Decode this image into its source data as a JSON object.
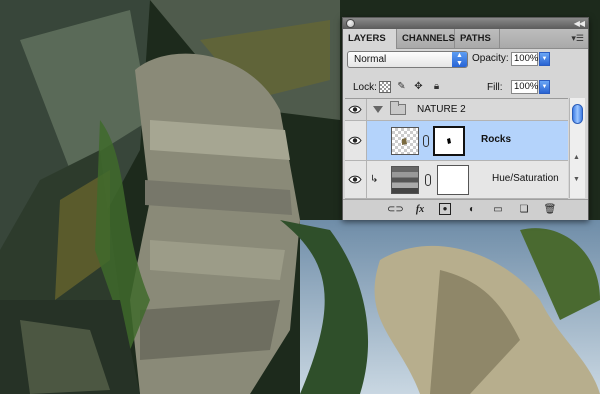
{
  "panel": {
    "tabs": [
      {
        "label": "LAYERS",
        "active": true
      },
      {
        "label": "CHANNELS",
        "active": false
      },
      {
        "label": "PATHS",
        "active": false
      }
    ],
    "blend_mode": "Normal",
    "opacity_label": "Opacity:",
    "opacity_value": "100%",
    "lock_label": "Lock:",
    "fill_label": "Fill:",
    "fill_value": "100%",
    "layers": [
      {
        "name": "NATURE 2",
        "type": "group",
        "expanded": true,
        "visible": true
      },
      {
        "name": "Rocks",
        "type": "layer-with-mask",
        "selected": true,
        "visible": true
      },
      {
        "name": "Hue/Saturation",
        "type": "adjustment",
        "clipped": true,
        "visible": true
      }
    ],
    "icons": {
      "eye": "eye-icon",
      "folder": "folder-icon",
      "link": "link-layers-icon",
      "fx": "layer-style-icon",
      "mask": "add-mask-icon",
      "adjustment": "adjustment-layer-icon",
      "new_group": "new-group-icon",
      "new_layer": "new-layer-icon",
      "delete": "trash-icon"
    },
    "fx_label": "fx",
    "accent_color": "#b4d3fb"
  }
}
